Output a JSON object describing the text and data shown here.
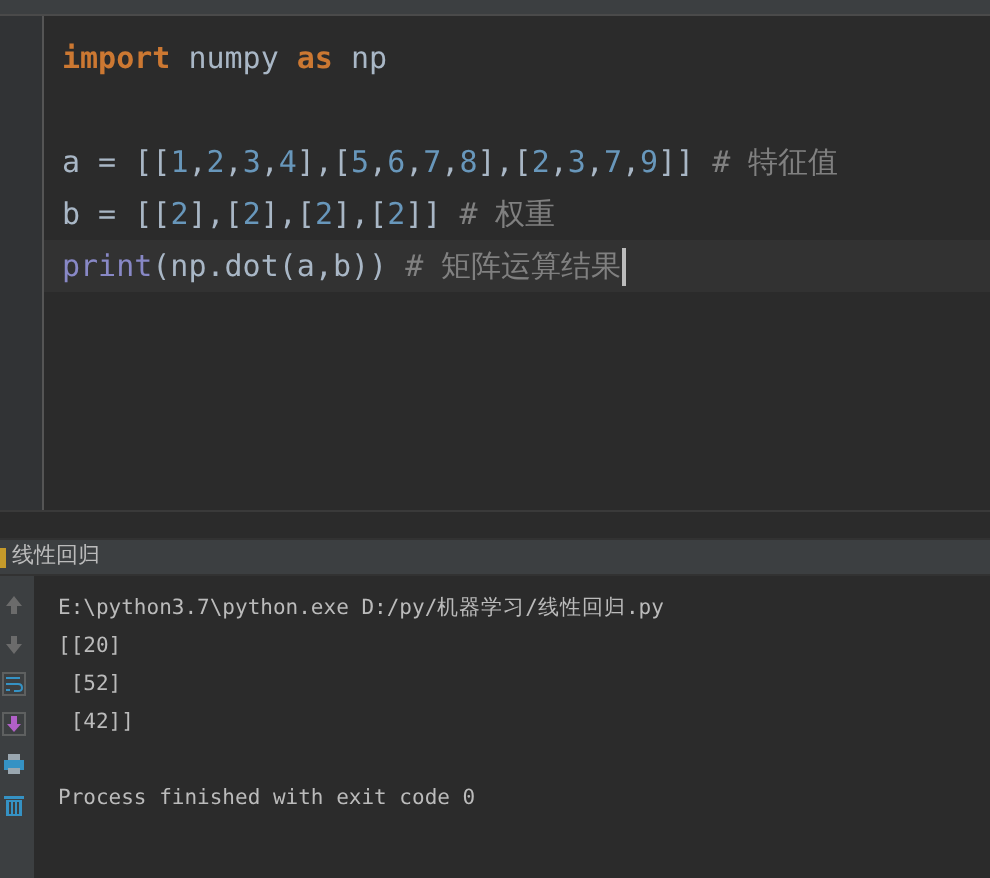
{
  "editor": {
    "lines": [
      {
        "current": false,
        "tokens": [
          {
            "kind": "keyword",
            "text": "import"
          },
          {
            "kind": "plain",
            "text": " numpy "
          },
          {
            "kind": "keyword",
            "text": "as"
          },
          {
            "kind": "plain",
            "text": " np"
          }
        ]
      },
      {
        "current": false
      },
      {
        "current": false,
        "tokens": [
          {
            "kind": "plain",
            "text": "a = [["
          },
          {
            "kind": "number",
            "text": "1"
          },
          {
            "kind": "plain",
            "text": ","
          },
          {
            "kind": "number",
            "text": "2"
          },
          {
            "kind": "plain",
            "text": ","
          },
          {
            "kind": "number",
            "text": "3"
          },
          {
            "kind": "plain",
            "text": ","
          },
          {
            "kind": "number",
            "text": "4"
          },
          {
            "kind": "plain",
            "text": "],["
          },
          {
            "kind": "number",
            "text": "5"
          },
          {
            "kind": "plain",
            "text": ","
          },
          {
            "kind": "number",
            "text": "6"
          },
          {
            "kind": "plain",
            "text": ","
          },
          {
            "kind": "number",
            "text": "7"
          },
          {
            "kind": "plain",
            "text": ","
          },
          {
            "kind": "number",
            "text": "8"
          },
          {
            "kind": "plain",
            "text": "],["
          },
          {
            "kind": "number",
            "text": "2"
          },
          {
            "kind": "plain",
            "text": ","
          },
          {
            "kind": "number",
            "text": "3"
          },
          {
            "kind": "plain",
            "text": ","
          },
          {
            "kind": "number",
            "text": "7"
          },
          {
            "kind": "plain",
            "text": ","
          },
          {
            "kind": "number",
            "text": "9"
          },
          {
            "kind": "plain",
            "text": "]] "
          },
          {
            "kind": "comment",
            "text": "# 特征值"
          }
        ]
      },
      {
        "current": false,
        "tokens": [
          {
            "kind": "plain",
            "text": "b = [["
          },
          {
            "kind": "number",
            "text": "2"
          },
          {
            "kind": "plain",
            "text": "],["
          },
          {
            "kind": "number",
            "text": "2"
          },
          {
            "kind": "plain",
            "text": "],["
          },
          {
            "kind": "number",
            "text": "2"
          },
          {
            "kind": "plain",
            "text": "],["
          },
          {
            "kind": "number",
            "text": "2"
          },
          {
            "kind": "plain",
            "text": "]] "
          },
          {
            "kind": "comment",
            "text": "# 权重"
          }
        ]
      },
      {
        "current": true,
        "tokens": [
          {
            "kind": "builtin",
            "text": "print"
          },
          {
            "kind": "plain",
            "text": "(np.dot(a,b)) "
          },
          {
            "kind": "comment",
            "text": "# 矩阵运算结果"
          }
        ]
      }
    ]
  },
  "run_panel": {
    "title": "线性回归",
    "output": [
      "E:\\python3.7\\python.exe D:/py/机器学习/线性回归.py",
      "[[20]",
      " [52]",
      " [42]]"
    ],
    "exit_message": "Process finished with exit code 0"
  }
}
